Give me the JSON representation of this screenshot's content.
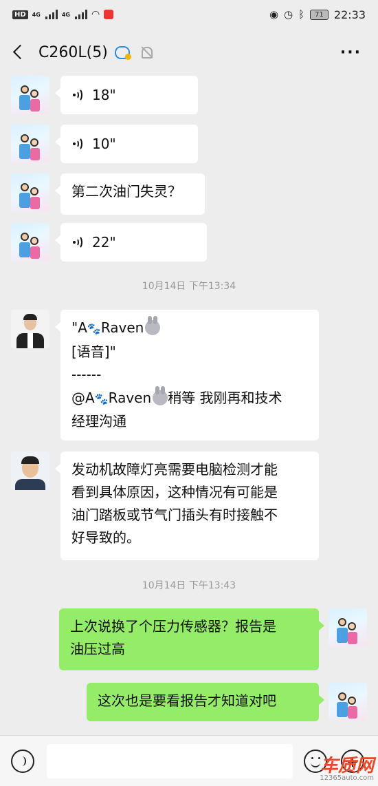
{
  "status_bar": {
    "hd": "HD",
    "network1": "4G",
    "network2": "4G",
    "battery": "71",
    "time": "22:33"
  },
  "header": {
    "title": "C260L(5)",
    "more": "···"
  },
  "messages": {
    "m1": {
      "duration": "18\""
    },
    "m2": {
      "duration": "10\""
    },
    "m3": {
      "text": "第二次油门失灵？"
    },
    "m4": {
      "duration": "22\""
    },
    "ts1": "10月14日 下午13:34",
    "m5": {
      "line1_prefix": "\"A",
      "line1_name": "Raven",
      "line2": "[语音]\"",
      "line3": "------",
      "line4_prefix": "@A",
      "line4_name": "Raven",
      "line4_rest": "稍等 我刚再和技术",
      "line5": "经理沟通"
    },
    "m6": {
      "line1": "发动机故障灯亮需要电脑检测才能",
      "line2": "看到具体原因，这种情况有可能是",
      "line3": "油门踏板或节气门插头有时接触不",
      "line4": "好导致的。"
    },
    "ts2": "10月14日 下午13:43",
    "m7": {
      "line1": "上次说换了个压力传感器？报告是",
      "line2": "油压过高"
    },
    "m8": {
      "text": "这次也是要看报告才知道对吧"
    }
  },
  "input_bar": {
    "placeholder": ""
  },
  "watermark": {
    "main": "车质网",
    "sub": "12365auto.com"
  }
}
